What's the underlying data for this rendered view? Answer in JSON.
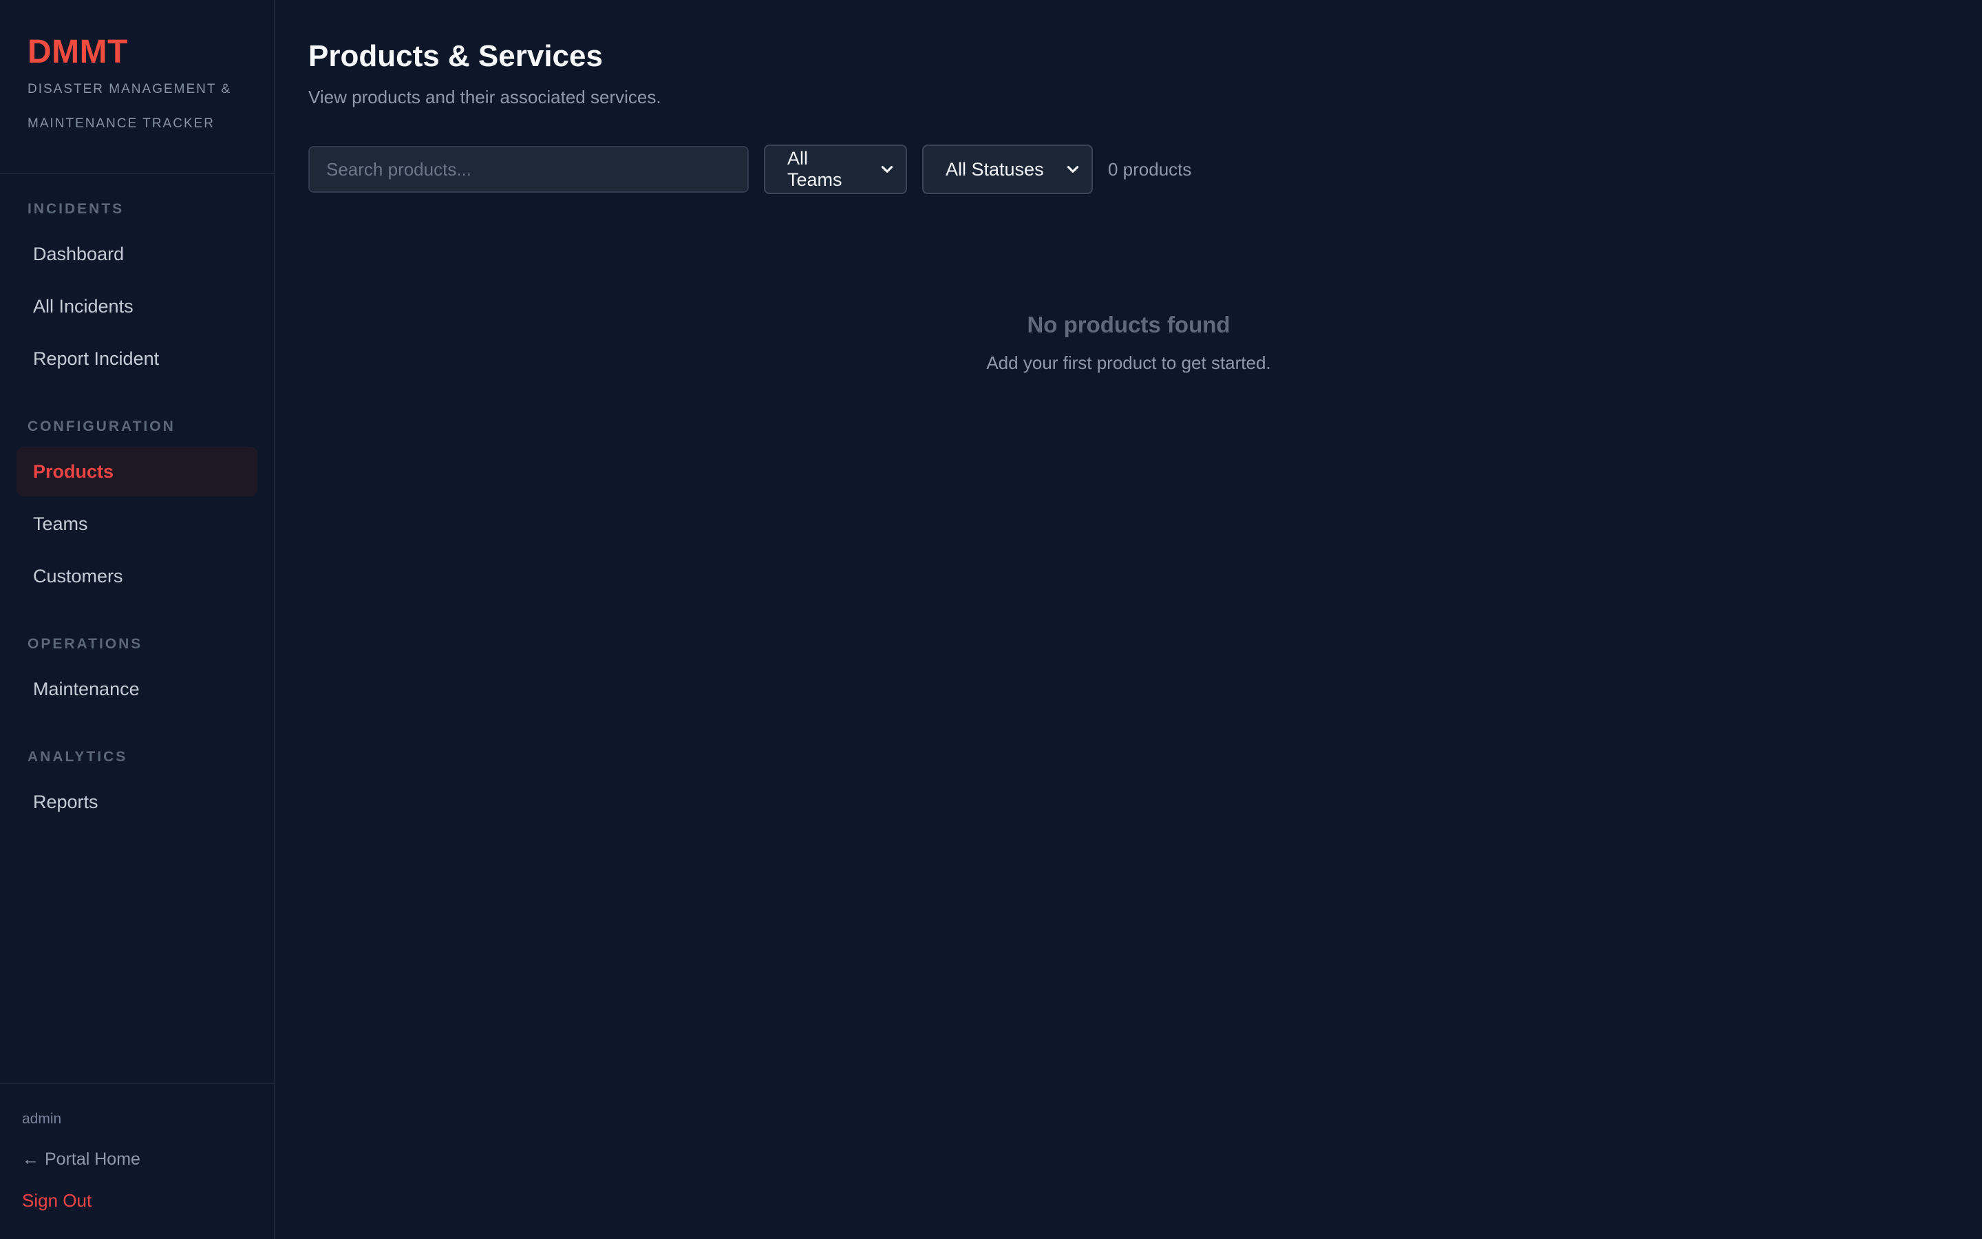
{
  "brand": {
    "title": "DMMT",
    "subtitle_line1": "DISASTER MANAGEMENT &",
    "subtitle_line2": "MAINTENANCE TRACKER"
  },
  "nav": {
    "sections": [
      {
        "title": "INCIDENTS",
        "items": [
          "Dashboard",
          "All Incidents",
          "Report Incident"
        ]
      },
      {
        "title": "CONFIGURATION",
        "items": [
          "Products",
          "Teams",
          "Customers"
        ]
      },
      {
        "title": "OPERATIONS",
        "items": [
          "Maintenance"
        ]
      },
      {
        "title": "ANALYTICS",
        "items": [
          "Reports"
        ]
      }
    ],
    "active_item": "Products"
  },
  "footer": {
    "user": "admin",
    "portal_home": "Portal Home",
    "sign_out": "Sign Out"
  },
  "main": {
    "title": "Products & Services",
    "subtitle": "View products and their associated services.",
    "search": {
      "placeholder": "Search products...",
      "value": ""
    },
    "filters": {
      "teams_selected": "All Teams",
      "status_selected": "All Statuses"
    },
    "product_count": "0 products",
    "empty": {
      "title": "No products found",
      "text": "Add your first product to get started."
    }
  },
  "colors": {
    "background": "#0e1729",
    "brand_accent": "#ef4b3f",
    "active_nav_text": "#ef4444",
    "active_nav_bg": "#1e1825",
    "sign_out": "#ef4444"
  },
  "icons": {
    "select_chevron": "chevron-down-icon",
    "portal_back": "arrow-left-icon"
  }
}
